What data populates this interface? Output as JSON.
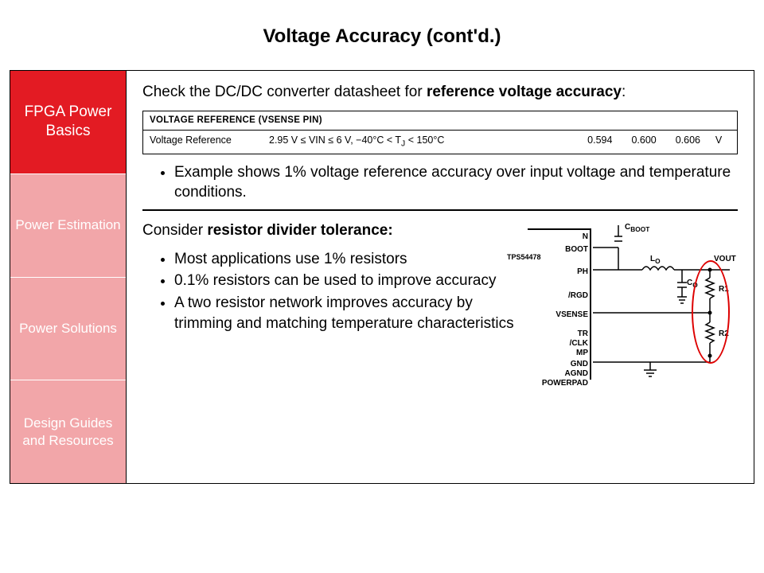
{
  "title": "Voltage Accuracy (cont'd.)",
  "sidebar": {
    "items": [
      {
        "label": "FPGA Power Basics"
      },
      {
        "label": "Power Estimation"
      },
      {
        "label": "Power Solutions"
      },
      {
        "label": "Design Guides and Resources"
      }
    ]
  },
  "section1": {
    "intro_pre": "Check the DC/DC converter datasheet for ",
    "intro_bold": "reference voltage accuracy",
    "intro_post": ":",
    "table": {
      "header": "VOLTAGE REFERENCE (VSENSE PIN)",
      "param": "Voltage Reference",
      "cond": "2.95 V ≤ VIN ≤ 6 V, −40°C < T",
      "cond_sub": "J",
      "cond_post": " < 150°C",
      "min": "0.594",
      "typ": "0.600",
      "max": "0.606",
      "unit": "V"
    },
    "bullet": "Example shows 1% voltage reference accuracy over input voltage and temperature conditions."
  },
  "section2": {
    "heading_pre": "Consider ",
    "heading_bold": "resistor divider tolerance:",
    "bullets": [
      "Most applications use 1% resistors",
      "0.1% resistors can be used to improve accuracy",
      "A two resistor network improves accuracy by trimming and matching temperature characteristics"
    ]
  },
  "schematic": {
    "chip": "TPS54478",
    "pins": {
      "n": "N",
      "boot": "BOOT",
      "ph": "PH",
      "rgd": "/RGD",
      "vsense": "VSENSE",
      "tr": "TR",
      "clk": "/CLK",
      "mp": "MP",
      "gnd": "GND",
      "agnd": "AGND",
      "powerpad": "POWERPAD"
    },
    "comps": {
      "cboot": "C",
      "cboot_sub": "BOOT",
      "lo": "L",
      "lo_sub": "O",
      "co": "C",
      "co_sub": "O",
      "r1": "R1",
      "r2": "R2",
      "vout": "VOUT"
    }
  }
}
